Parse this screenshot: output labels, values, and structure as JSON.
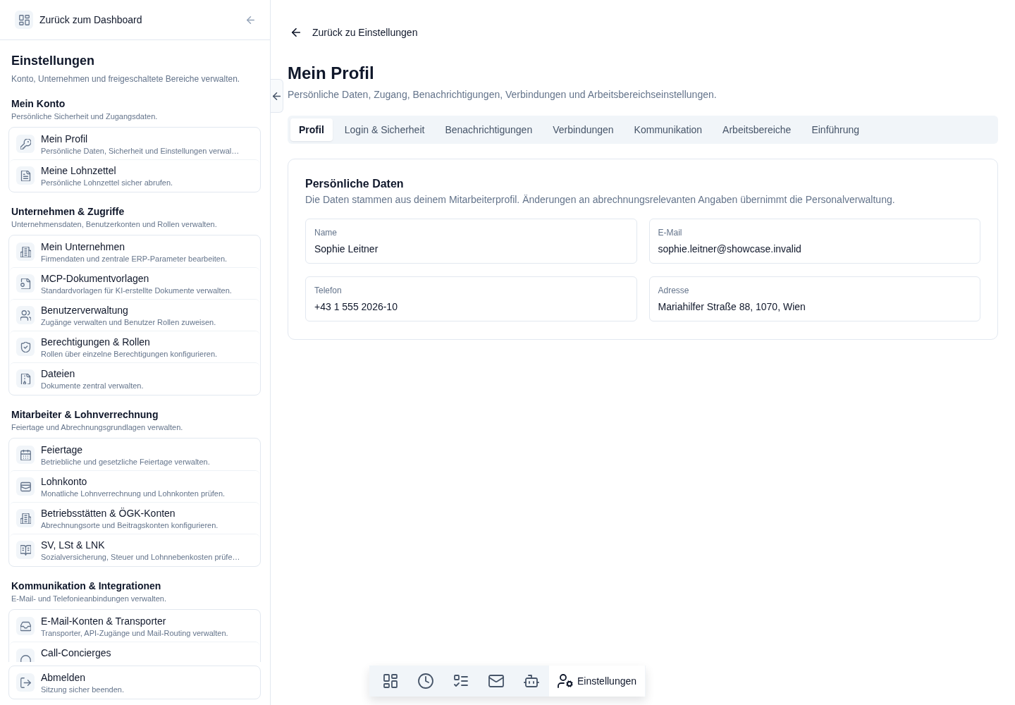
{
  "sidebar": {
    "back_link": {
      "label": "Zurück zum Dashboard"
    },
    "title": "Einstellungen",
    "subtitle": "Konto, Unternehmen und freigeschaltete Bereiche verwalten.",
    "sections": [
      {
        "title": "Mein Konto",
        "description": "Persönliche Sicherheit und Zugangsdaten.",
        "items": [
          {
            "title": "Mein Profil",
            "description": "Persönliche Daten, Sicherheit und Einstellungen verwal…"
          },
          {
            "title": "Meine Lohnzettel",
            "description": "Persönliche Lohnzettel sicher abrufen."
          }
        ]
      },
      {
        "title": "Unternehmen & Zugriffe",
        "description": "Unternehmensdaten, Benutzerkonten und Rollen verwalten.",
        "items": [
          {
            "title": "Mein Unternehmen",
            "description": "Firmendaten und zentrale ERP-Parameter bearbeiten."
          },
          {
            "title": "MCP-Dokumentvorlagen",
            "description": "Standardvorlagen für KI-erstellte Dokumente verwalten."
          },
          {
            "title": "Benutzerverwaltung",
            "description": "Zugänge verwalten und Benutzer Rollen zuweisen."
          },
          {
            "title": "Berechtigungen & Rollen",
            "description": "Rollen über einzelne Berechtigungen konfigurieren."
          },
          {
            "title": "Dateien",
            "description": "Dokumente zentral verwalten."
          }
        ]
      },
      {
        "title": "Mitarbeiter & Lohnverrechnung",
        "description": "Feiertage und Abrechnungsgrundlagen verwalten.",
        "items": [
          {
            "title": "Feiertage",
            "description": "Betriebliche und gesetzliche Feiertage verwalten."
          },
          {
            "title": "Lohnkonto",
            "description": "Monatliche Lohnverrechnung und Lohnkonten prüfen."
          },
          {
            "title": "Betriebsstätten & ÖGK-Konten",
            "description": "Abrechnungsorte und Beitragskonten konfigurieren."
          },
          {
            "title": "SV, LSt & LNK",
            "description": "Sozialversicherung, Steuer und Lohnnebenkosten prüfe…"
          }
        ]
      },
      {
        "title": "Kommunikation & Integrationen",
        "description": "E-Mail- und Telefonieanbindungen verwalten.",
        "items": [
          {
            "title": "E-Mail-Konten & Transporter",
            "description": "Transporter, API-Zugänge und Mail-Routing verwalten."
          },
          {
            "title": "Call-Concierges"
          }
        ]
      }
    ],
    "footer_item": {
      "title": "Abmelden",
      "description": "Sitzung sicher beenden."
    }
  },
  "page": {
    "back_link": "Zurück zu Einstellungen",
    "title": "Mein Profil",
    "subtitle": "Persönliche Daten, Zugang, Benachrichtigungen, Verbindungen und Arbeitsbereichseinstellungen."
  },
  "tabs": [
    {
      "label": "Profil",
      "selected": true
    },
    {
      "label": "Login & Sicherheit",
      "selected": false
    },
    {
      "label": "Benachrichtigungen",
      "selected": false
    },
    {
      "label": "Verbindungen",
      "selected": false
    },
    {
      "label": "Kommunikation",
      "selected": false
    },
    {
      "label": "Arbeitsbereiche",
      "selected": false
    },
    {
      "label": "Einführung",
      "selected": false
    }
  ],
  "card": {
    "title": "Persönliche Daten",
    "description": "Die Daten stammen aus deinem Mitarbeiterprofil. Änderungen an abrechnungsrelevanten Angaben übernimmt die Personalverwaltung.",
    "fields": [
      {
        "label": "Name",
        "value": "Sophie Leitner"
      },
      {
        "label": "E-Mail",
        "value": "sophie.leitner@showcase.invalid"
      },
      {
        "label": "Telefon",
        "value": "+43 1 555 2026-10"
      },
      {
        "label": "Adresse",
        "value": "Mariahilfer Straße 88, 1070, Wien"
      }
    ]
  },
  "dock": [
    {
      "selected": false
    },
    {
      "selected": false
    },
    {
      "selected": false
    },
    {
      "selected": false
    },
    {
      "selected": false
    },
    {
      "label": "Einstellungen",
      "selected": true
    }
  ]
}
